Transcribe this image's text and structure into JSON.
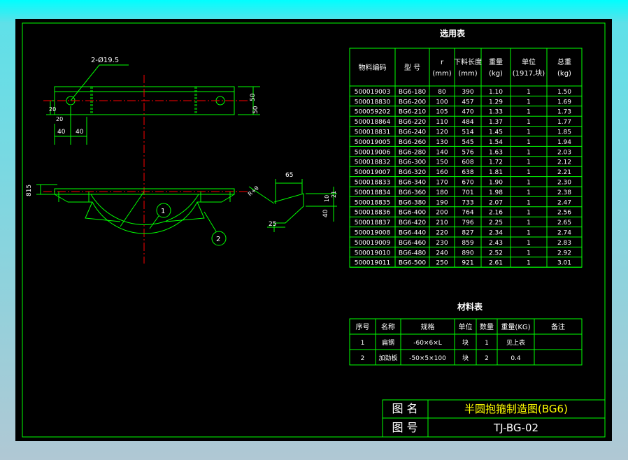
{
  "colors": {
    "line": "#00ff00",
    "text": "#ffffff",
    "center": "#ff0000",
    "title_text": "#ffff00",
    "frame_bg": "#000000"
  },
  "drawing": {
    "hole_label": "2-Ø19.5",
    "dims": {
      "d20a": "20",
      "d20b": "20",
      "d40a": "40",
      "d40b": "40",
      "d50": "50",
      "d30": "50",
      "d815": "815",
      "d65": "65",
      "d25": "25",
      "d40c": "40",
      "d10": "10",
      "d21": "21",
      "weld": "R+θ"
    },
    "balloons": [
      "1",
      "2"
    ]
  },
  "selection_table": {
    "title": "选用表",
    "headers": {
      "code": "物料编码",
      "model": "型 号",
      "r": "r",
      "r_unit": "(mm)",
      "len": "下料长度",
      "len_unit": "(mm)",
      "wt": "重量",
      "wt_unit": "(kg)",
      "unit": "单位",
      "unit_sub": "(1917,块)",
      "total": "总重",
      "total_unit": "(kg)"
    },
    "rows": [
      [
        "500019003",
        "BG6-180",
        "80",
        "390",
        "1.10",
        "1",
        "1.50"
      ],
      [
        "500018830",
        "BG6-200",
        "100",
        "457",
        "1.29",
        "1",
        "1.69"
      ],
      [
        "500059202",
        "BG6-210",
        "105",
        "470",
        "1.33",
        "1",
        "1.73"
      ],
      [
        "500018864",
        "BG6-220",
        "110",
        "484",
        "1.37",
        "1",
        "1.77"
      ],
      [
        "500018831",
        "BG6-240",
        "120",
        "514",
        "1.45",
        "1",
        "1.85"
      ],
      [
        "500019005",
        "BG6-260",
        "130",
        "545",
        "1.54",
        "1",
        "1.94"
      ],
      [
        "500019006",
        "BG6-280",
        "140",
        "576",
        "1.63",
        "1",
        "2.03"
      ],
      [
        "500018832",
        "BG6-300",
        "150",
        "608",
        "1.72",
        "1",
        "2.12"
      ],
      [
        "500019007",
        "BG6-320",
        "160",
        "638",
        "1.81",
        "1",
        "2.21"
      ],
      [
        "500018833",
        "BG6-340",
        "170",
        "670",
        "1.90",
        "1",
        "2.30"
      ],
      [
        "500018834",
        "BG6-360",
        "180",
        "701",
        "1.98",
        "1",
        "2.38"
      ],
      [
        "500018835",
        "BG6-380",
        "190",
        "733",
        "2.07",
        "1",
        "2.47"
      ],
      [
        "500018836",
        "BG6-400",
        "200",
        "764",
        "2.16",
        "1",
        "2.56"
      ],
      [
        "500018837",
        "BG6-420",
        "210",
        "796",
        "2.25",
        "1",
        "2.65"
      ],
      [
        "500019008",
        "BG6-440",
        "220",
        "827",
        "2.34",
        "1",
        "2.74"
      ],
      [
        "500019009",
        "BG6-460",
        "230",
        "859",
        "2.43",
        "1",
        "2.83"
      ],
      [
        "500019010",
        "BG6-480",
        "240",
        "890",
        "2.52",
        "1",
        "2.92"
      ],
      [
        "500019011",
        "BG6-500",
        "250",
        "921",
        "2.61",
        "1",
        "3.01"
      ]
    ]
  },
  "material_table": {
    "title": "材料表",
    "headers": [
      "序号",
      "名称",
      "规格",
      "单位",
      "数量",
      "重量(KG)",
      "备注"
    ],
    "rows": [
      [
        "1",
        "扁钢",
        "-60×6×L",
        "块",
        "1",
        "见上表",
        ""
      ],
      [
        "2",
        "加劲板",
        "-50×5×100",
        "块",
        "2",
        "0.4",
        ""
      ]
    ]
  },
  "title_block": {
    "name_label": "图  名",
    "name_value": "半圆抱箍制造图(BG6)",
    "no_label": "图  号",
    "no_value": "TJ-BG-02"
  }
}
